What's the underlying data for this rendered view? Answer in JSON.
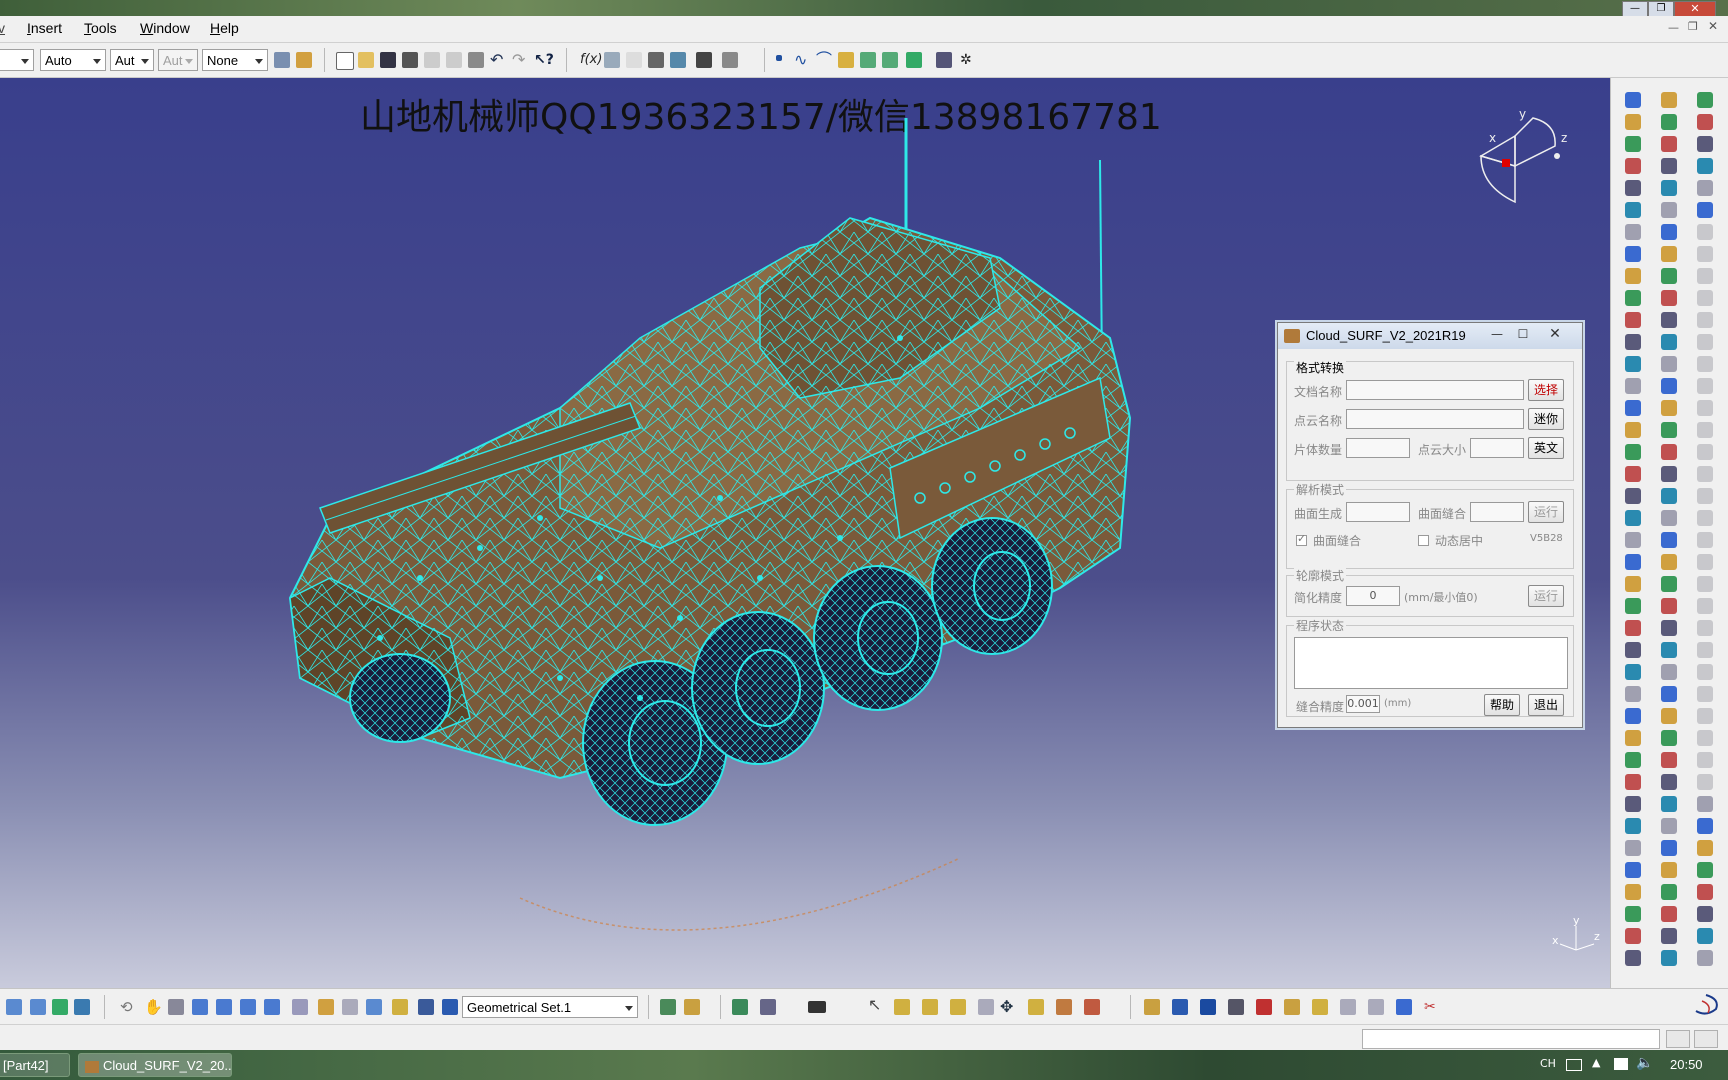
{
  "menu": {
    "items": [
      {
        "label": "Insert"
      },
      {
        "label": "Tools"
      },
      {
        "label": "Window"
      },
      {
        "label": "Help"
      }
    ]
  },
  "toolbar": {
    "combo_color": "Auto",
    "combo_linetype": "Aut",
    "combo_thickness": "Aut",
    "combo_layer": "None"
  },
  "viewport": {
    "watermark": "山地机械师QQ1936323157/微信13898167781",
    "compass": {
      "x": "x",
      "y": "y",
      "z": "z"
    },
    "axis": {
      "x": "x",
      "y": "y",
      "z": "z"
    }
  },
  "dialog": {
    "title": "Cloud_SURF_V2_2021R19",
    "section_format": {
      "label": "格式转换",
      "doc_name_label": "文档名称",
      "cloud_name_label": "点云名称",
      "piece_count_label": "片体数量",
      "cloud_size_label": "点云大小",
      "select_button": "选择",
      "mini_button": "迷你",
      "english_button": "英文"
    },
    "section_analysis": {
      "label": "解析模式",
      "surface_gen_label": "曲面生成",
      "surface_sew_label": "曲面缝合",
      "run_button": "运行",
      "chk_surface_sew": "曲面缝合",
      "chk_dynamic_center": "动态居中",
      "version": "V5B28"
    },
    "section_contour": {
      "label": "轮廓模式",
      "simplify_label": "简化精度",
      "simplify_value": "0",
      "simplify_unit": "(mm/最小值0)",
      "run_button": "运行"
    },
    "section_status": {
      "label": "程序状态"
    },
    "footer": {
      "sew_precision_label": "缝合精度",
      "sew_precision_value": "0.001",
      "unit": "(mm)",
      "help_button": "帮助",
      "exit_button": "退出"
    }
  },
  "bottom_toolbar": {
    "geometrical_set": "Geometrical Set.1"
  },
  "taskbar": {
    "items": [
      {
        "label": "[Part42]"
      },
      {
        "label": "Cloud_SURF_V2_20..."
      }
    ],
    "lang": "CH",
    "time": "20:50"
  },
  "colors": {
    "mesh": "#2ee8e8",
    "body": "#7a5a3a",
    "viewport_top": "#393f8c",
    "viewport_bottom": "#c9cbdc",
    "select_text": "#c00000"
  }
}
